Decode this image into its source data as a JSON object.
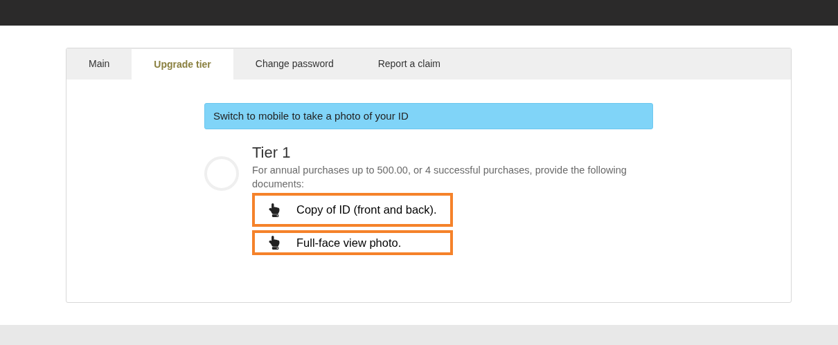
{
  "tabs": [
    {
      "label": "Main",
      "selected": false
    },
    {
      "label": "Upgrade tier",
      "selected": true
    },
    {
      "label": "Change password",
      "selected": false
    },
    {
      "label": "Report a claim",
      "selected": false
    }
  ],
  "alert": {
    "text": "Switch to mobile to take a photo of your ID"
  },
  "tier": {
    "title": "Tier 1",
    "checked": false,
    "description": "For annual purchases up to 500.00, or 4 successful purchases, provide the following documents:",
    "documents": [
      {
        "label": "Copy of ID (front and back)."
      },
      {
        "label": "Full-face view photo."
      }
    ]
  }
}
